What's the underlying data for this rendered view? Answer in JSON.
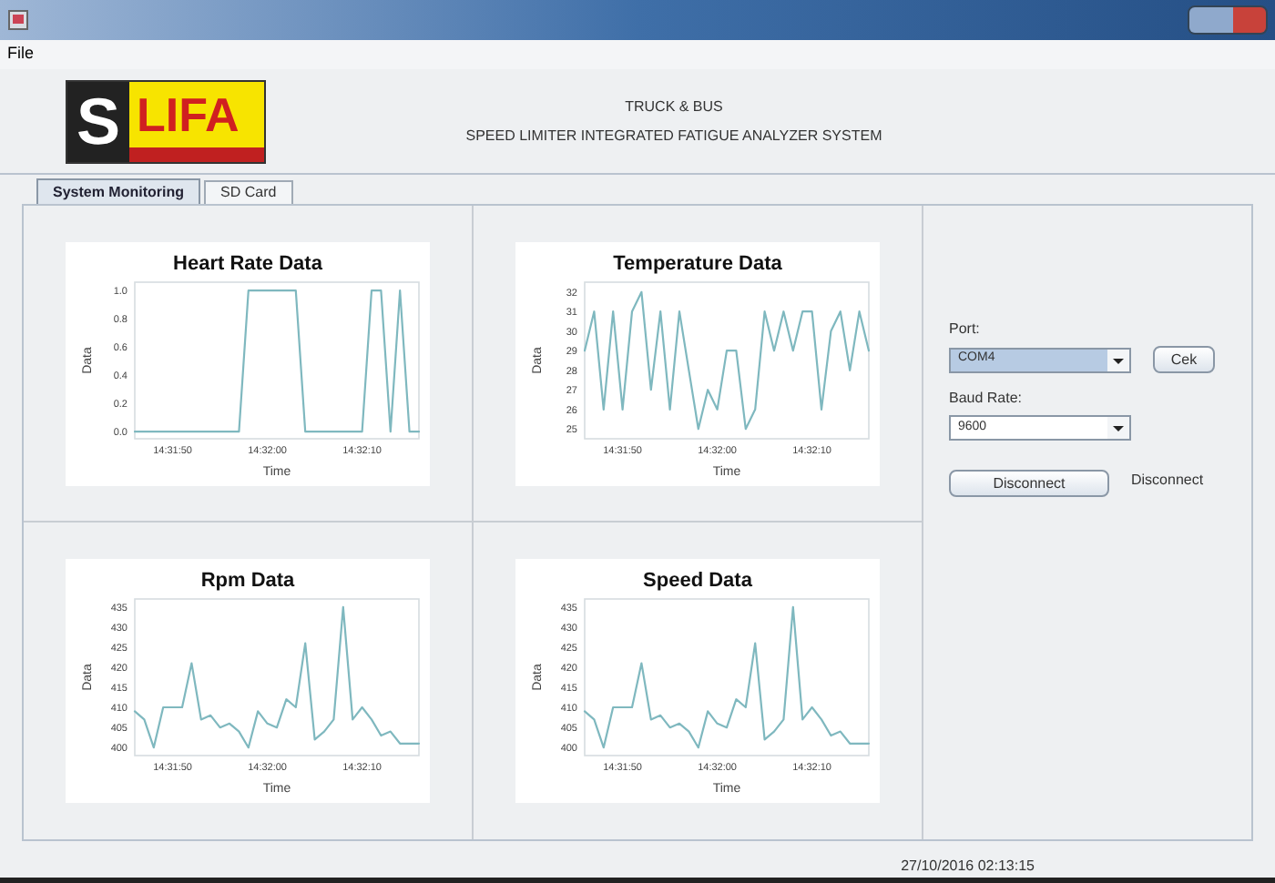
{
  "menu": [
    "File"
  ],
  "logo": {
    "letter": "S",
    "text": "LIFA"
  },
  "header": {
    "line_1": "TRUCK & BUS",
    "line_2": "SPEED LIMITER INTEGRATED FATIGUE ANALYZER SYSTEM"
  },
  "tabs": [
    {
      "label": "System Monitoring",
      "selected": true
    },
    {
      "label": "SD Card",
      "selected": false
    }
  ],
  "charts": [
    {
      "chart_data": {
        "type": "line",
        "title": "Heart Rate Data",
        "xlabel": "Time",
        "ylabel": "Data",
        "categories": [
          null,
          null,
          null,
          null,
          "14:31:50",
          null,
          null,
          null,
          null,
          null,
          null,
          null,
          null,
          null,
          "14:32:00",
          null,
          null,
          null,
          null,
          null,
          null,
          null,
          null,
          null,
          "14:32:10",
          null,
          null,
          null,
          null,
          null,
          null
        ],
        "ylim": [
          -0.05,
          1.06
        ],
        "yticks": [
          {
            "value": 0,
            "label": "0.0"
          },
          {
            "value": 0.2,
            "label": "0.2"
          },
          {
            "value": 0.4,
            "label": "0.4"
          },
          {
            "value": 0.6,
            "label": "0.6"
          },
          {
            "value": 0.8,
            "label": "0.8"
          },
          {
            "value": 1,
            "label": "1.0"
          }
        ],
        "series": [
          {
            "color": "#7fb8bf",
            "values": [
              0,
              0,
              0,
              0,
              0,
              0,
              0,
              0,
              0,
              0,
              0,
              0,
              1,
              1,
              1,
              1,
              1,
              1,
              0,
              0,
              0,
              0,
              0,
              0,
              0,
              1,
              1,
              0,
              1,
              0,
              0
            ]
          }
        ]
      }
    },
    {
      "chart_data": {
        "type": "line",
        "title": "Temperature Data",
        "xlabel": "Time",
        "ylabel": "Data",
        "categories": [
          null,
          null,
          null,
          null,
          "14:31:50",
          null,
          null,
          null,
          null,
          null,
          null,
          null,
          null,
          null,
          "14:32:00",
          null,
          null,
          null,
          null,
          null,
          null,
          null,
          null,
          null,
          "14:32:10",
          null,
          null,
          null,
          null,
          null,
          null
        ],
        "ylim": [
          24.5,
          32.5
        ],
        "yticks": [
          25,
          26,
          27,
          28,
          29,
          30,
          31,
          32
        ],
        "series": [
          {
            "color": "#7fb8bf",
            "values": [
              29,
              31,
              26,
              31,
              26,
              31,
              32,
              27,
              31,
              26,
              31,
              28,
              25,
              27,
              26,
              29,
              29,
              25,
              26,
              31,
              29,
              31,
              29,
              31,
              31,
              26,
              30,
              31,
              28,
              31,
              29
            ]
          }
        ]
      }
    },
    {
      "chart_data": {
        "type": "line",
        "title": "Rpm Data",
        "xlabel": "Time",
        "ylabel": "Data",
        "categories": [
          null,
          null,
          null,
          null,
          "14:31:50",
          null,
          null,
          null,
          null,
          null,
          null,
          null,
          null,
          null,
          "14:32:00",
          null,
          null,
          null,
          null,
          null,
          null,
          null,
          null,
          null,
          "14:32:10",
          null,
          null,
          null,
          null,
          null,
          null
        ],
        "ylim": [
          398,
          437
        ],
        "yticks": [
          400,
          405,
          410,
          415,
          420,
          425,
          430,
          435
        ],
        "series": [
          {
            "color": "#7fb8bf",
            "values": [
              409,
              407,
              400,
              410,
              410,
              410,
              421,
              407,
              408,
              405,
              406,
              404,
              400,
              409,
              406,
              405,
              412,
              410,
              426,
              402,
              404,
              407,
              435,
              407,
              410,
              407,
              403,
              404,
              401,
              401,
              401
            ]
          }
        ]
      }
    },
    {
      "chart_data": {
        "type": "line",
        "title": "Speed Data",
        "xlabel": "Time",
        "ylabel": "Data",
        "categories": [
          null,
          null,
          null,
          null,
          "14:31:50",
          null,
          null,
          null,
          null,
          null,
          null,
          null,
          null,
          null,
          "14:32:00",
          null,
          null,
          null,
          null,
          null,
          null,
          null,
          null,
          null,
          "14:32:10",
          null,
          null,
          null,
          null,
          null,
          null
        ],
        "ylim": [
          398,
          437
        ],
        "yticks": [
          400,
          405,
          410,
          415,
          420,
          425,
          430,
          435
        ],
        "series": [
          {
            "color": "#7fb8bf",
            "values": [
              409,
              407,
              400,
              410,
              410,
              410,
              421,
              407,
              408,
              405,
              406,
              404,
              400,
              409,
              406,
              405,
              412,
              410,
              426,
              402,
              404,
              407,
              435,
              407,
              410,
              407,
              403,
              404,
              401,
              401,
              401
            ]
          }
        ]
      }
    }
  ],
  "connection": {
    "port_label": "Port:",
    "port": {
      "value": "COM4",
      "focused": true
    },
    "check_button": "Cek",
    "baud_label": "Baud Rate:",
    "baud": {
      "value": "9600",
      "focused": false
    },
    "connect_button": "Disconnect",
    "status": "Disconnect"
  },
  "status_bar": {
    "timestamp": "27/10/2016 02:13:15"
  }
}
